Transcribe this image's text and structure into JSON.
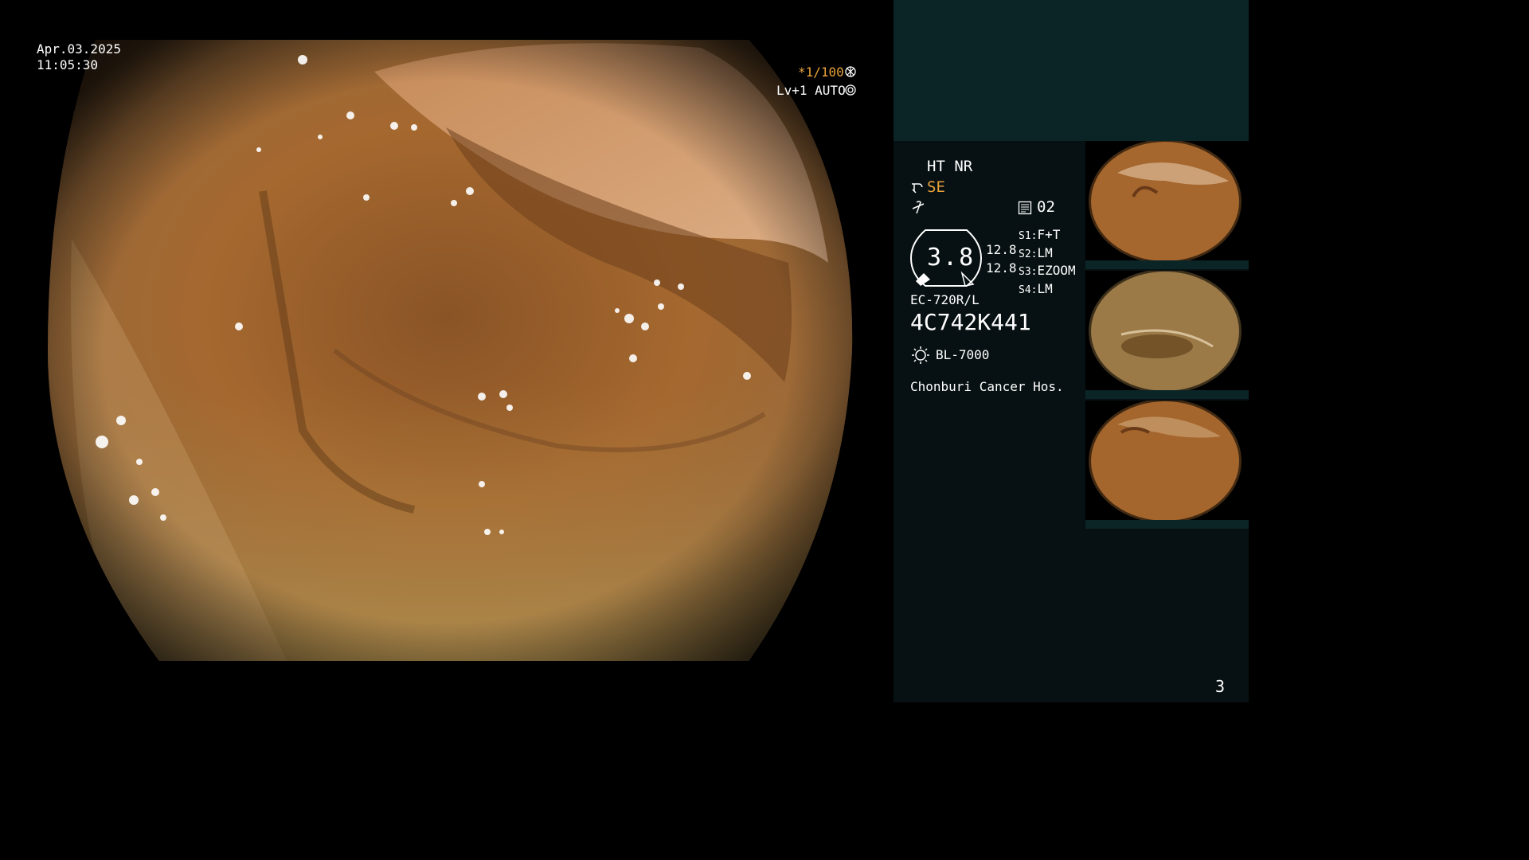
{
  "overlay": {
    "date": "Apr.03.2025",
    "time": "11:05:30",
    "shutter": "*1/100",
    "level": "Lv+1 AUTO"
  },
  "panel": {
    "ht_nr": "HT NR",
    "se": "SE",
    "memo_count": "02",
    "gauge_value": "3.8",
    "gauge_side_1": "12.8",
    "gauge_side_2": "12.8",
    "switches": [
      {
        "key": "S1",
        "value": "F+T"
      },
      {
        "key": "S2",
        "value": "LM"
      },
      {
        "key": "S3",
        "value": "EZOOM"
      },
      {
        "key": "S4",
        "value": "LM"
      }
    ],
    "scope_model": "EC-720R/L",
    "scope_serial": "4C742K441",
    "light_source": "BL-7000",
    "hospital": "Chonburi Cancer Hos.",
    "page_number": "3"
  },
  "colors": {
    "accent": "#e8a23a",
    "panel_top": "#0b2426",
    "panel_bg": "#071012"
  }
}
